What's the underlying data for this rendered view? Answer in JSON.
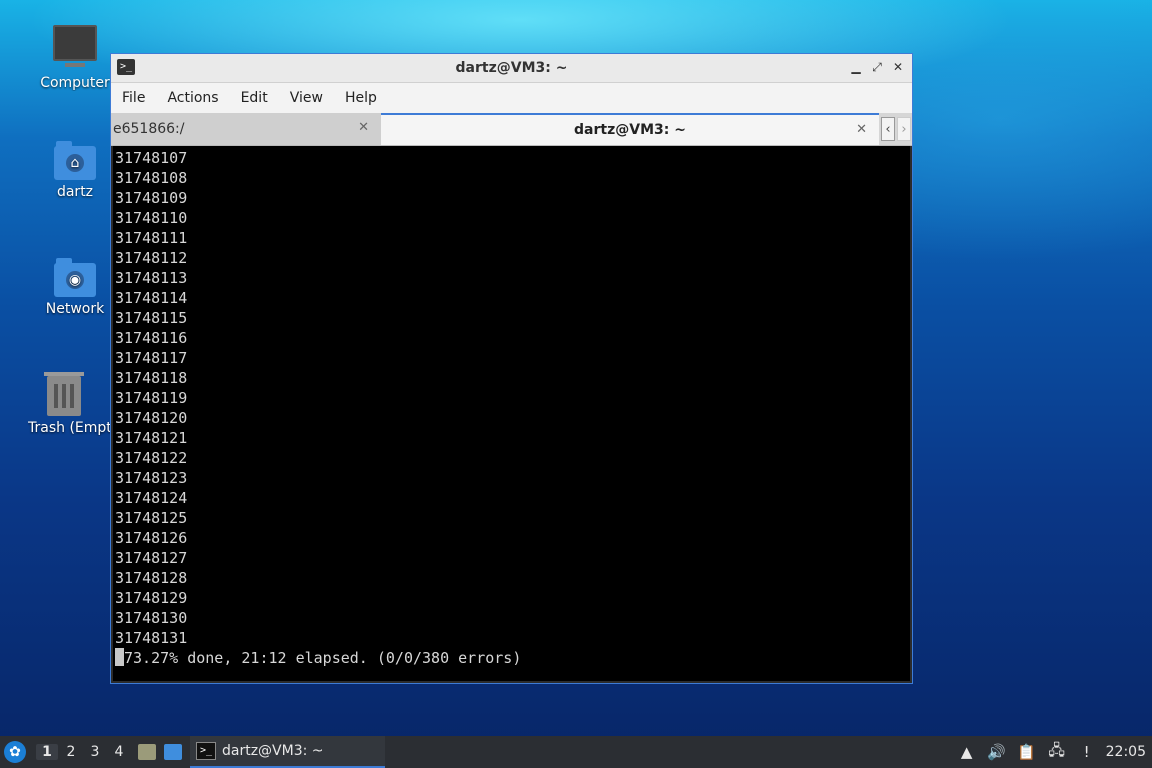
{
  "desktop": {
    "icons": [
      {
        "label": "Computer"
      },
      {
        "label": "dartz"
      },
      {
        "label": "Network"
      },
      {
        "label": "Trash (Empty)"
      }
    ]
  },
  "window": {
    "title": "dartz@VM3: ~",
    "menu": [
      "File",
      "Actions",
      "Edit",
      "View",
      "Help"
    ],
    "tabs": [
      {
        "label": "e651866:/"
      },
      {
        "label": "dartz@VM3: ~"
      }
    ],
    "terminal_lines": [
      "31748107",
      "31748108",
      "31748109",
      "31748110",
      "31748111",
      "31748112",
      "31748113",
      "31748114",
      "31748115",
      "31748116",
      "31748117",
      "31748118",
      "31748119",
      "31748120",
      "31748121",
      "31748122",
      "31748123",
      "31748124",
      "31748125",
      "31748126",
      "31748127",
      "31748128",
      "31748129",
      "31748130",
      "31748131"
    ],
    "status_line": "73.27% done, 21:12 elapsed. (0/0/380 errors)"
  },
  "taskbar": {
    "workspaces": [
      "1",
      "2",
      "3",
      "4"
    ],
    "active_workspace": "1",
    "task_label": "dartz@VM3: ~",
    "clock": "22:05"
  }
}
